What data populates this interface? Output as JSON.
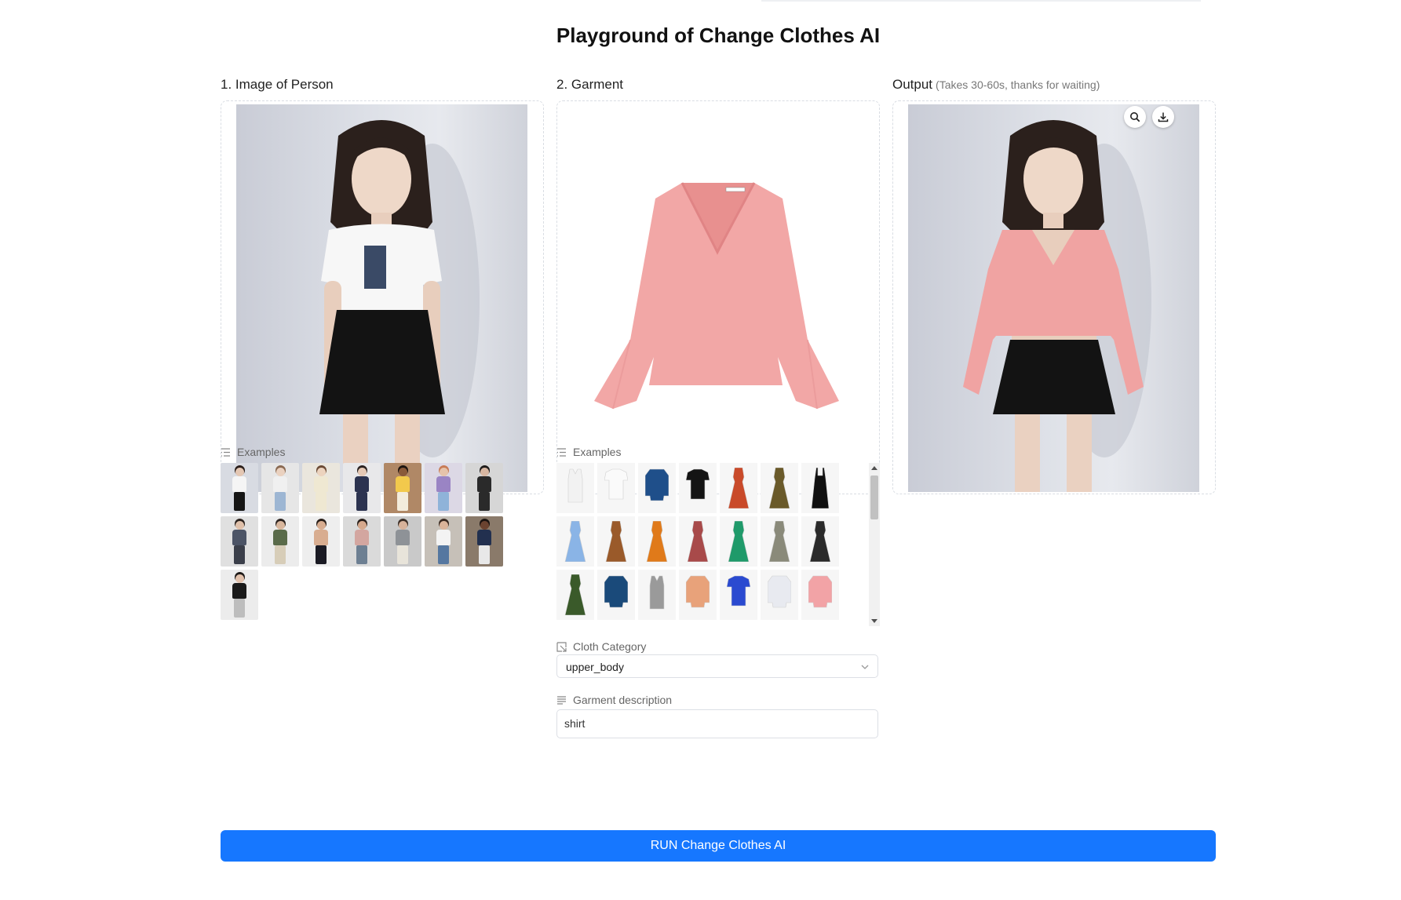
{
  "page": {
    "title": "Playground of Change Clothes AI"
  },
  "person": {
    "title": "1. Image of Person",
    "examples_label": "Examples",
    "examples": [
      {
        "skin": "#e4c7b3",
        "hair": "#2a1e1a",
        "top": "#f5f5f5",
        "bottom": "#151515",
        "bg": "#d8dbe2"
      },
      {
        "skin": "#ead1bf",
        "hair": "#8a6a52",
        "top": "#f0f0f0",
        "bottom": "#9db6d3",
        "bg": "#e6e6e6"
      },
      {
        "skin": "#ecd3be",
        "hair": "#6b4a35",
        "top": "#efe8d2",
        "bottom": "#efe8d2",
        "bg": "#eae6dd"
      },
      {
        "skin": "#e6c9b5",
        "hair": "#2b2220",
        "top": "#2c3350",
        "bottom": "#2c3350",
        "bg": "#e8e8ea"
      },
      {
        "skin": "#8a5a3a",
        "hair": "#1c1410",
        "top": "#f2c94c",
        "bottom": "#f3ecdc",
        "bg": "#b08866"
      },
      {
        "skin": "#e5c3ab",
        "hair": "#c87b55",
        "top": "#9a84c4",
        "bottom": "#8fb3d9",
        "bg": "#dcd8e5"
      },
      {
        "skin": "#d8b7a2",
        "hair": "#1e1b1a",
        "top": "#2a2a2a",
        "bottom": "#2a2a2a",
        "bg": "#d6d6d6"
      },
      {
        "skin": "#dfc0aa",
        "hair": "#2a221e",
        "top": "#4c5466",
        "bottom": "#3b3f4a",
        "bg": "#e0e0e0"
      },
      {
        "skin": "#d9b79d",
        "hair": "#2d2420",
        "top": "#5a6b4a",
        "bottom": "#d7cdb8",
        "bg": "#ececec"
      },
      {
        "skin": "#d8ad90",
        "hair": "#2a1f1a",
        "top": "#d8ad90",
        "bottom": "#1b1b24",
        "bg": "#eeeeee"
      },
      {
        "skin": "#d6a98d",
        "hair": "#2a201b",
        "top": "#d3a6a0",
        "bottom": "#6d7f92",
        "bg": "#dadada"
      },
      {
        "skin": "#d7b29a",
        "hair": "#3b2e26",
        "top": "#8e9297",
        "bottom": "#e8e4da",
        "bg": "#c9c9c9"
      },
      {
        "skin": "#dbb49a",
        "hair": "#3a2a22",
        "top": "#f3f3f3",
        "bottom": "#5577a0",
        "bg": "#c6c0b8"
      },
      {
        "skin": "#6b4330",
        "hair": "#1a1310",
        "top": "#22304f",
        "bottom": "#e8e8e8",
        "bg": "#8a7a6a"
      },
      {
        "skin": "#e2c2ad",
        "hair": "#1e1a18",
        "top": "#1a1a1a",
        "bottom": "#bdbdbd",
        "bg": "#ececec"
      }
    ]
  },
  "garment": {
    "title": "2. Garment",
    "examples_label": "Examples",
    "examples": [
      {
        "shape": "tank",
        "color": "#f2f2f2"
      },
      {
        "shape": "tee",
        "color": "#fafafa"
      },
      {
        "shape": "blouse",
        "color": "#1f4f8a"
      },
      {
        "shape": "tee",
        "color": "#141414"
      },
      {
        "shape": "dress",
        "color": "#c94a2a"
      },
      {
        "shape": "dress",
        "color": "#6a5a2a"
      },
      {
        "shape": "slip",
        "color": "#111111"
      },
      {
        "shape": "dress",
        "color": "#8ab4e6"
      },
      {
        "shape": "dress",
        "color": "#9a5a2a"
      },
      {
        "shape": "dress",
        "color": "#e07a1a"
      },
      {
        "shape": "dress",
        "color": "#a84a4a"
      },
      {
        "shape": "dress",
        "color": "#1f9a6a"
      },
      {
        "shape": "dress",
        "color": "#8a8a7a"
      },
      {
        "shape": "dress",
        "color": "#2a2a2a"
      },
      {
        "shape": "dress",
        "color": "#3a5a2a"
      },
      {
        "shape": "blouse",
        "color": "#1a4a7a"
      },
      {
        "shape": "tank",
        "color": "#9a9a9a"
      },
      {
        "shape": "blouse",
        "color": "#e8a27a"
      },
      {
        "shape": "tee",
        "color": "#2a4ad0"
      },
      {
        "shape": "blouse",
        "color": "#e8eaf0"
      },
      {
        "shape": "blouse",
        "color": "#f2a3a6"
      }
    ],
    "category_label": "Cloth Category",
    "category_value": "upper_body",
    "description_label": "Garment description",
    "description_value": "shirt"
  },
  "output": {
    "title": "Output",
    "note": "(Takes 30-60s, thanks for waiting)"
  },
  "run_button": "RUN Change Clothes AI"
}
